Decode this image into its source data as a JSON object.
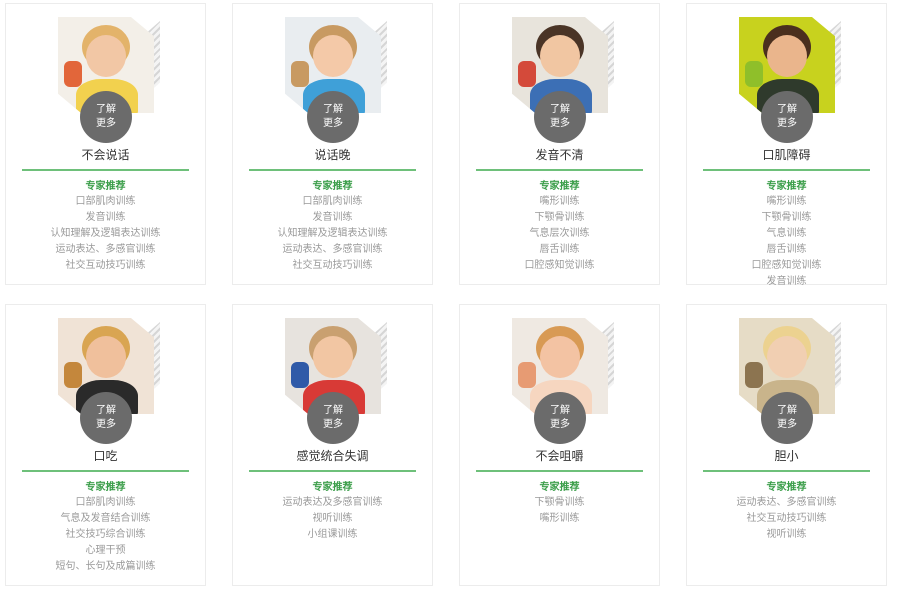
{
  "learn_more": [
    "了解",
    "更多"
  ],
  "cards": [
    {
      "title": "不会说话",
      "rec": "专家推荐",
      "items": [
        "口部肌肉训练",
        "发音训练",
        "认知理解及逻辑表达训练",
        "运动表达、多感官训练",
        "社交互动技巧训练"
      ],
      "photo": {
        "bg": "#f3efe8",
        "skin": "#f2c7a5",
        "hair": "#e3b36a",
        "cloth": "#f2d14e",
        "accent": "#e2663a"
      }
    },
    {
      "title": "说话晚",
      "rec": "专家推荐",
      "items": [
        "口部肌肉训练",
        "发音训练",
        "认知理解及逻辑表达训练",
        "运动表达、多感官训练",
        "社交互动技巧训练"
      ],
      "photo": {
        "bg": "#e9edf0",
        "skin": "#f4c9a8",
        "hair": "#c89a62",
        "cloth": "#3fa0d8",
        "accent": "#c89a62"
      }
    },
    {
      "title": "发音不清",
      "rec": "专家推荐",
      "items": [
        "嘴形训练",
        "下颚骨训练",
        "气息层次训练",
        "唇舌训练",
        "口腔感知觉训练"
      ],
      "photo": {
        "bg": "#e8e4dc",
        "skin": "#f1c6a2",
        "hair": "#4a3426",
        "cloth": "#3c6fb5",
        "accent": "#d44a3a"
      }
    },
    {
      "title": "口肌障碍",
      "rec": "专家推荐",
      "items": [
        "嘴形训练",
        "下颚骨训练",
        "气息训练",
        "唇舌训练",
        "口腔感知觉训练",
        "发音训练"
      ],
      "photo": {
        "bg": "#c8d21e",
        "skin": "#eab58c",
        "hair": "#4a2f1e",
        "cloth": "#2f3a2c",
        "accent": "#8fbf2a"
      }
    },
    {
      "title": "口吃",
      "rec": "专家推荐",
      "items": [
        "口部肌肉训练",
        "气息及发音结合训练",
        "社交技巧综合训练",
        "心理干预",
        "短句、长句及成篇训练"
      ],
      "photo": {
        "bg": "#f0e3d6",
        "skin": "#f0c09c",
        "hair": "#d9a552",
        "cloth": "#2a2a2a",
        "accent": "#c4873c"
      }
    },
    {
      "title": "感觉统合失调",
      "rec": "专家推荐",
      "items": [
        "运动表达及多感官训练",
        "视听训练",
        "小组课训练"
      ],
      "photo": {
        "bg": "#e7e3de",
        "skin": "#f2c6a3",
        "hair": "#c9a070",
        "cloth": "#d83a36",
        "accent": "#2f5aa8"
      }
    },
    {
      "title": "不会咀嚼",
      "rec": "专家推荐",
      "items": [
        "下颚骨训练",
        "嘴形训练"
      ],
      "photo": {
        "bg": "#efe9e2",
        "skin": "#f3c3a3",
        "hair": "#d89a54",
        "cloth": "#f6d6c0",
        "accent": "#e79b73"
      }
    },
    {
      "title": "胆小",
      "rec": "专家推荐",
      "items": [
        "运动表达、多感官训练",
        "社交互动技巧训练",
        "视听训练"
      ],
      "photo": {
        "bg": "#e6dcc6",
        "skin": "#f1cfb2",
        "hair": "#ecd290",
        "cloth": "#c9b48b",
        "accent": "#8c7450"
      }
    }
  ]
}
